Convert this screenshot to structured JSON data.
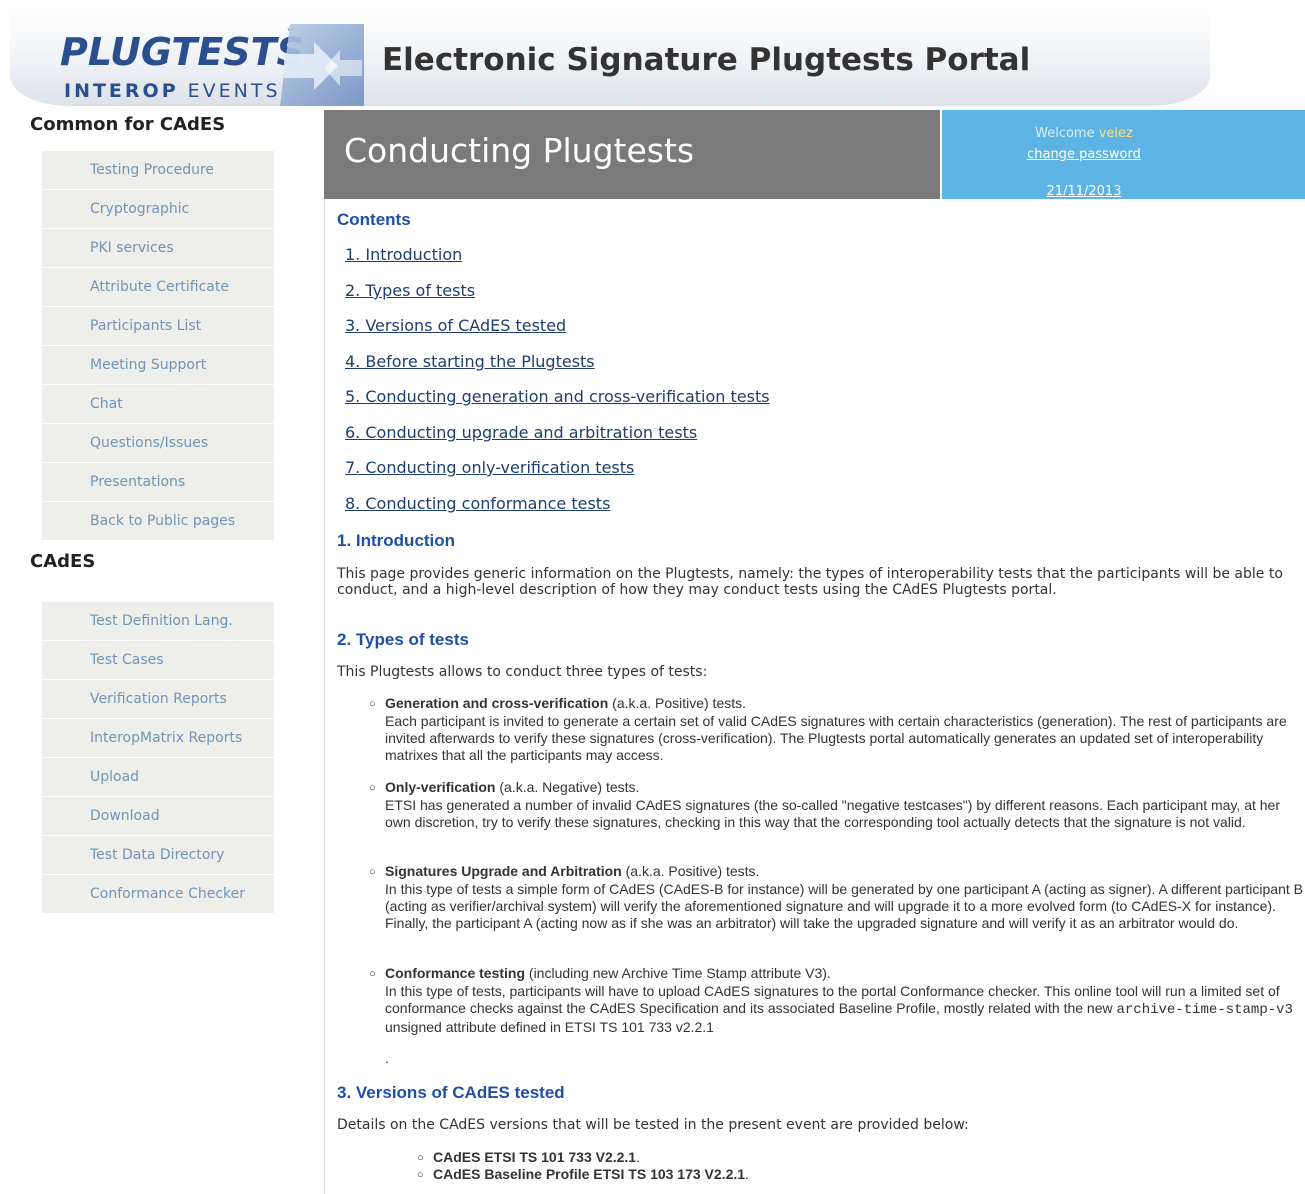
{
  "header": {
    "logo_main": "PLUGTESTS",
    "logo_tm": "™",
    "logo_sub_bold": "INTEROP",
    "logo_sub_rest": " EVENTS",
    "site_title": "Electronic Signature Plugtests Portal"
  },
  "sidebar": {
    "section1_heading": "Common for CAdES",
    "section1_items": [
      "Testing Procedure",
      "Cryptographic",
      "PKI services",
      "Attribute Certificate",
      "Participants List",
      "Meeting Support",
      "Chat",
      "Questions/Issues",
      "Presentations",
      "Back to Public pages"
    ],
    "section2_heading": "CAdES",
    "section2_items": [
      "Test Definition Lang.",
      "Test Cases",
      "Verification Reports",
      "InteropMatrix Reports",
      "Upload",
      "Download",
      "Test Data Directory",
      "Conformance Checker"
    ]
  },
  "page": {
    "title": "Conducting Plugtests"
  },
  "user": {
    "welcome": "Welcome",
    "username": "velez",
    "change_password": "change password",
    "date": "21/11/2013"
  },
  "contents": {
    "heading": "Contents",
    "items": [
      "1. Introduction",
      "2. Types of tests",
      "3. Versions of CAdES tested",
      "4. Before starting the Plugtests",
      "5. Conducting generation and cross-verification tests",
      "6. Conducting upgrade and arbitration tests",
      "7. Conducting only-verification tests",
      "8. Conducting conformance tests"
    ]
  },
  "intro": {
    "heading": "1. Introduction",
    "text": "This page provides generic information on the Plugtests, namely: the types of interoperability tests that the participants will be able to conduct, and a high-level description of how they may conduct tests using the CAdES Plugtests portal."
  },
  "types": {
    "heading": "2. Types of tests",
    "intro": "This Plugtests allows to conduct three types of tests:",
    "items": [
      {
        "title": "Generation and cross-verification",
        "qualifier": " (a.k.a. Positive) tests.",
        "body": "Each participant is invited to generate a certain set of valid CAdES signatures with certain characteristics (generation). The rest of participants are invited afterwards to verify these signatures (cross-verification). The Plugtests portal automatically generates an updated set of interoperability matrixes that all the participants may access."
      },
      {
        "title": "Only-verification",
        "qualifier": " (a.k.a. Negative) tests.",
        "body": "ETSI has generated a number of invalid CAdES signatures (the so-called \"negative testcases\") by different reasons. Each participant may, at her own discretion, try to verify these signatures, checking in this way that the corresponding tool actually detects that the signature is not valid."
      },
      {
        "title": "Signatures Upgrade and Arbitration",
        "qualifier": " (a.k.a. Positive) tests.",
        "body": "In this type of tests a simple form of CAdES (CAdES-B for instance) will be generated by one participant A (acting as signer). A different participant B (acting as verifier/archival system) will verify the aforementioned signature and will upgrade it to a more evolved form (to CAdES-X for instance). Finally, the participant A (acting now as if she was an arbitrator) will take the upgraded signature and will verify it as an arbitrator would do."
      },
      {
        "title": "Conformance testing",
        "qualifier": " (including new Archive Time Stamp attribute V3).",
        "body_before": "In this type of tests, participants will have to upload CAdES signatures to the portal Conformance checker. This online tool will run a limited set of conformance checks against the CAdES Specification and its associated Baseline Profile, mostly related with the new ",
        "body_code": "archive-time-stamp-v3",
        "body_after": " unsigned attribute defined in ETSI TS 101 733 v2.2.1"
      }
    ],
    "trailing_dot": "."
  },
  "versions": {
    "heading": "3. Versions of CAdES tested",
    "intro": "Details on the CAdES versions that will be tested in the present event are provided below:",
    "items": [
      {
        "prefix": "CAdES ETSI TS ",
        "bold": "101 733 V2.2.1",
        "suffix": "."
      },
      {
        "prefix": "CAdES Baseline Profile ETSI TS ",
        "bold": "103 173 V2.2.1",
        "suffix": "."
      }
    ]
  },
  "colors": {
    "title_bar": "#7a7a7a",
    "user_box": "#5db4e4",
    "heading_blue": "#1d4fa8",
    "menu_bg": "#eeeeea",
    "menu_text": "#7094b8"
  }
}
